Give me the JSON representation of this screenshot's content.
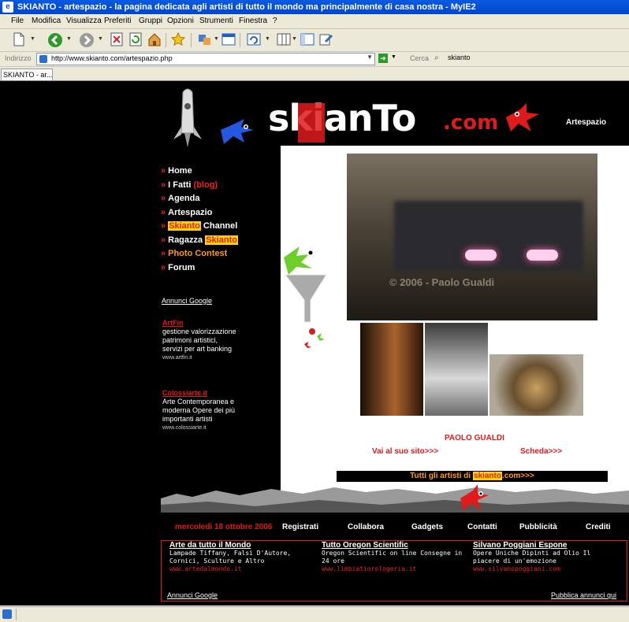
{
  "window": {
    "title": "SKIANTO - artespazio - la pagina dedicata agli artisti di tutto il mondo ma principalmente di casa nostra - MyIE2"
  },
  "menu": [
    "File",
    "Modifica",
    "Visualizza",
    "Preferiti",
    "Gruppi",
    "Opzioni",
    "Strumenti",
    "Finestra",
    "?"
  ],
  "address": {
    "label": "Indirizzo",
    "url": "http://www.skianto.com/artespazio.php"
  },
  "search": {
    "label": "Cerca",
    "value": "skianto"
  },
  "tab": {
    "label": "SKIANTO - ar..."
  },
  "site": {
    "logo_text": "skianTo",
    "logo_com": ".com",
    "section": "Artespazio",
    "nav": {
      "home": "Home",
      "ifatti": "I Fatti",
      "blog": "(blog)",
      "agenda": "Agenda",
      "artespazio": "Artespazio",
      "skianto": "Skianto",
      "channel": "Channel",
      "ragazza": "Ragazza",
      "photo": "Photo Contest",
      "forum": "Forum"
    },
    "google_ads": {
      "label": "Annunci Google",
      "ad1": {
        "title": "ArtFin",
        "l1": "gestione valorizzazione",
        "l2": "patrimoni artistici,",
        "l3": "servizi per art banking",
        "url": "www.artfin.it"
      },
      "ad2": {
        "title": "Colossiarte.it",
        "l1": "Arte Contemporanea e",
        "l2": "moderna Opere dei più",
        "l3": "importanti artisti",
        "url": "www.colossiarte.it"
      }
    },
    "photo_credit": "© 2006 - Paolo Gualdi",
    "artist": {
      "name": "PAOLO GUALDI",
      "site_link": "Vai al suo sito>>>",
      "scheda_link": "Scheda>>>"
    },
    "tutti": {
      "pre": "Tutti gli artisti di",
      "hl": "skianto",
      "post": ".com>>>"
    },
    "footer": {
      "date": "mercoledì 18 ottobre 2006",
      "links": {
        "registrati": "Registrati",
        "collabora": "Collabora",
        "gadgets": "Gadgets",
        "contatti": "Contatti",
        "pubblicita": "Pubblicità",
        "crediti": "Crediti"
      }
    },
    "bottom_ads": {
      "a1": {
        "title": "Arte da tutto il Mondo",
        "desc": "Lampade Tiffany, Falsi D'Autore, Cornici, Sculture e Altro",
        "url": "www.artedalmondo.it"
      },
      "a2": {
        "title": "Tutto Oregon Scientific",
        "desc": "Oregon Scientific on line Consegne in 24 ore",
        "url": "www.limbiatiorologeria.it"
      },
      "a3": {
        "title": "Silvano Poggiani Espone",
        "desc": "Opere Uniche Dipinti ad Olio Il piacere di un'emozione",
        "url": "www.silvanopoggiani.com"
      },
      "google_label": "Annunci Google",
      "publish": "Pubblica annunci qui"
    }
  },
  "colors": {
    "accent_red": "#e01b1b",
    "highlight_yellow": "#ffd200",
    "xp_blue": "#0a5ae0"
  }
}
